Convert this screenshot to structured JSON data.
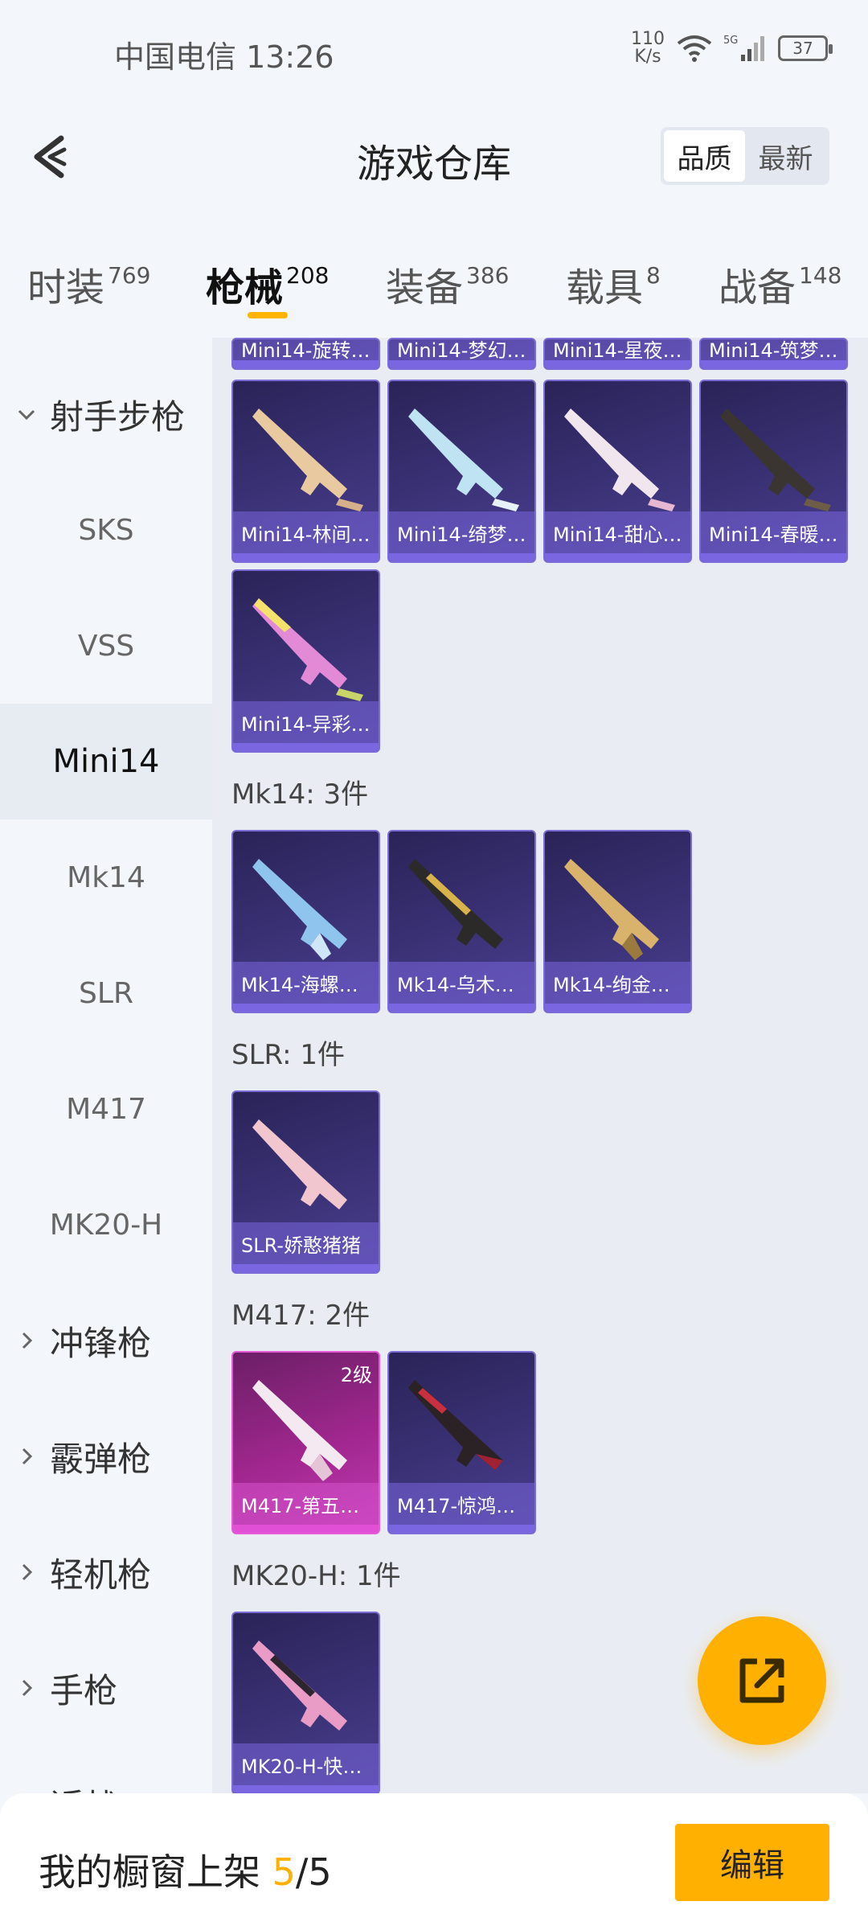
{
  "status_bar": {
    "carrier_time": "中国电信 13:26",
    "net_speed_value": "110",
    "net_speed_unit": "K/s",
    "network": "5G",
    "battery": "37"
  },
  "header": {
    "title": "游戏仓库",
    "sort_options": [
      "品质",
      "最新"
    ],
    "active_sort": "品质"
  },
  "tabs": [
    {
      "label": "时装",
      "count": "769"
    },
    {
      "label": "枪械",
      "count": "208"
    },
    {
      "label": "装备",
      "count": "386"
    },
    {
      "label": "载具",
      "count": "8"
    },
    {
      "label": "战备",
      "count": "148"
    }
  ],
  "active_tab": "枪械",
  "sidebar": {
    "expanded_group": "射手步枪",
    "sub_items": [
      "SKS",
      "VSS",
      "Mini14",
      "Mk14",
      "SLR",
      "M417",
      "MK20-H"
    ],
    "active_sub_item": "Mini14",
    "collapsed_groups": [
      "冲锋枪",
      "霰弹枪",
      "轻机枪",
      "手枪",
      "近战"
    ]
  },
  "content": {
    "top_partial_cards": [
      "Mini14-旋转…",
      "Mini14-梦幻…",
      "Mini14-星夜…",
      "Mini14-筑梦…"
    ],
    "mini14_cards": [
      "Mini14-林间…",
      "Mini14-绮梦…",
      "Mini14-甜心…",
      "Mini14-春暖…",
      "Mini14-异彩…"
    ],
    "sections": [
      {
        "title": "Mk14: 3件",
        "cards": [
          "Mk14-海螺…",
          "Mk14-乌木…",
          "Mk14-绚金…"
        ]
      },
      {
        "title": "SLR: 1件",
        "cards": [
          "SLR-娇憨猪猪"
        ]
      },
      {
        "title": "M417: 2件",
        "cards": [
          "M417-第五…",
          "M417-惊鸿…"
        ],
        "level_badge": "2级"
      },
      {
        "title": "MK20-H: 1件",
        "cards": [
          "MK20-H-快…"
        ]
      }
    ]
  },
  "bottom_bar": {
    "shelf_label": "我的橱窗上架",
    "shelf_current": "5",
    "shelf_total": "/5",
    "edit_label": "编辑"
  },
  "icons": {
    "back": "back-chevron-icon",
    "fab": "share-external-icon",
    "wifi": "wifi-icon",
    "signal": "signal-icon",
    "battery": "battery-icon"
  },
  "colors": {
    "accent": "#ffb000",
    "card_purple": "#3b3277",
    "card_pink": "#a1278f"
  }
}
